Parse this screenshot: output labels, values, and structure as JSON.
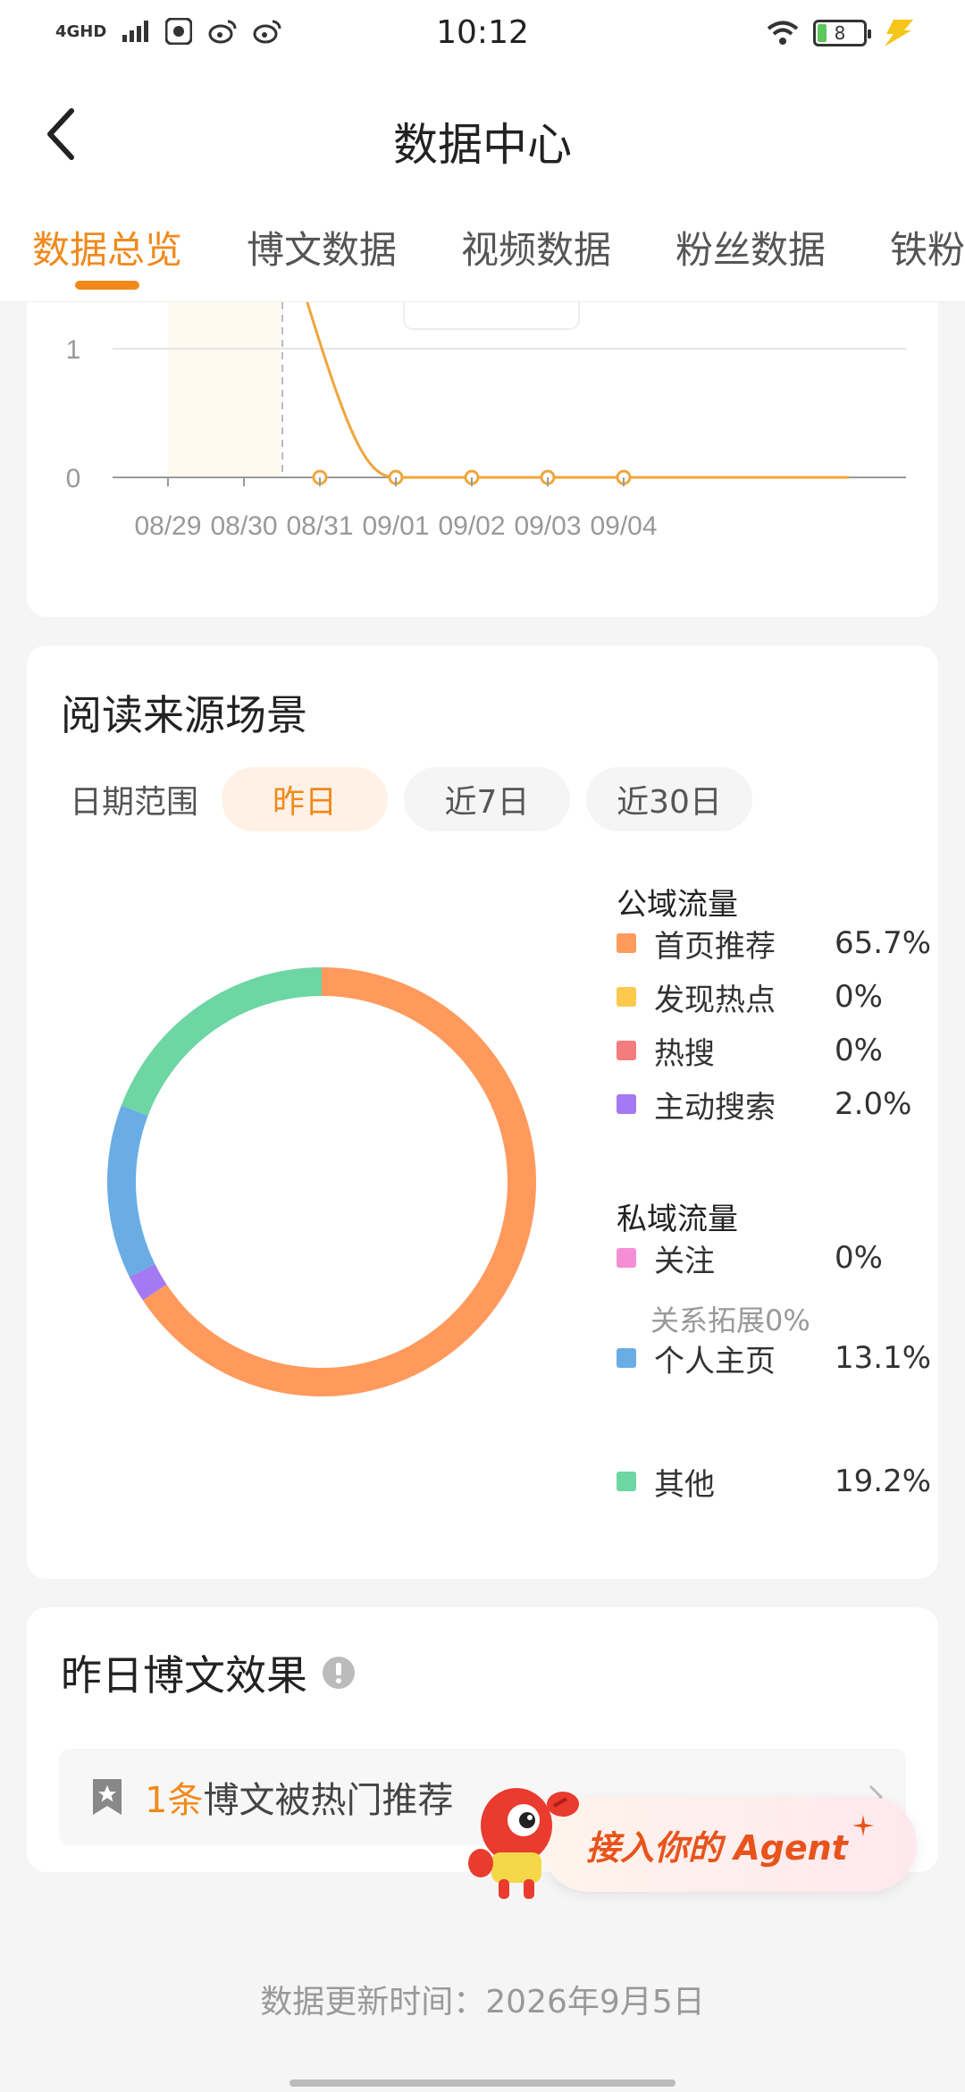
{
  "status_bar": {
    "network": "4GHD",
    "time": "10:12",
    "battery": "8"
  },
  "nav": {
    "title": "数据中心"
  },
  "tabs": [
    {
      "label": "数据总览",
      "active": true
    },
    {
      "label": "博文数据",
      "active": false
    },
    {
      "label": "视频数据",
      "active": false
    },
    {
      "label": "粉丝数据",
      "active": false
    },
    {
      "label": "铁粉",
      "active": false
    }
  ],
  "trend_chart": {
    "y_ticks": [
      "1",
      "0"
    ],
    "x_ticks": [
      "08/29",
      "08/30",
      "08/31",
      "09/01",
      "09/02",
      "09/03",
      "09/04"
    ]
  },
  "read_source": {
    "title": "阅读来源场景",
    "date_range_label": "日期范围",
    "date_options": [
      {
        "label": "昨日",
        "active": true
      },
      {
        "label": "近7日",
        "active": false
      },
      {
        "label": "近30日",
        "active": false
      }
    ],
    "public_heading": "公域流量",
    "private_heading": "私域流量",
    "public_items": [
      {
        "name": "首页推荐",
        "value": "65.7%",
        "color": "#ff9a5c"
      },
      {
        "name": "发现热点",
        "value": "0%",
        "color": "#ffc94d"
      },
      {
        "name": "热搜",
        "value": "0%",
        "color": "#f47c7c"
      },
      {
        "name": "主动搜索",
        "value": "2.0%",
        "color": "#a479f2"
      }
    ],
    "private_items": [
      {
        "name": "关注",
        "value": "0%",
        "color": "#f48fd6"
      },
      {
        "name": "个人主页",
        "value": "13.1%",
        "color": "#6aade4"
      }
    ],
    "relation_note": "关系拓展0%",
    "other_item": {
      "name": "其他",
      "value": "19.2%",
      "color": "#6dd6a2"
    }
  },
  "chart_data": {
    "type": "pie",
    "title": "",
    "categories": [
      "首页推荐",
      "发现热点",
      "热搜",
      "主动搜索",
      "关注",
      "个人主页",
      "其他"
    ],
    "values": [
      65.7,
      0,
      0,
      2.0,
      0,
      13.1,
      19.2
    ],
    "colors": [
      "#ff9a5c",
      "#ffc94d",
      "#f47c7c",
      "#a479f2",
      "#f48fd6",
      "#6aade4",
      "#6dd6a2"
    ],
    "donut": true,
    "legend": "right"
  },
  "yesterday_effect": {
    "title": "昨日博文效果",
    "count": "1条",
    "text": "博文被热门推荐"
  },
  "agent_button": {
    "label": "接入你的 Agent"
  },
  "footer": {
    "update_text": "数据更新时间：2026年9月5日"
  }
}
